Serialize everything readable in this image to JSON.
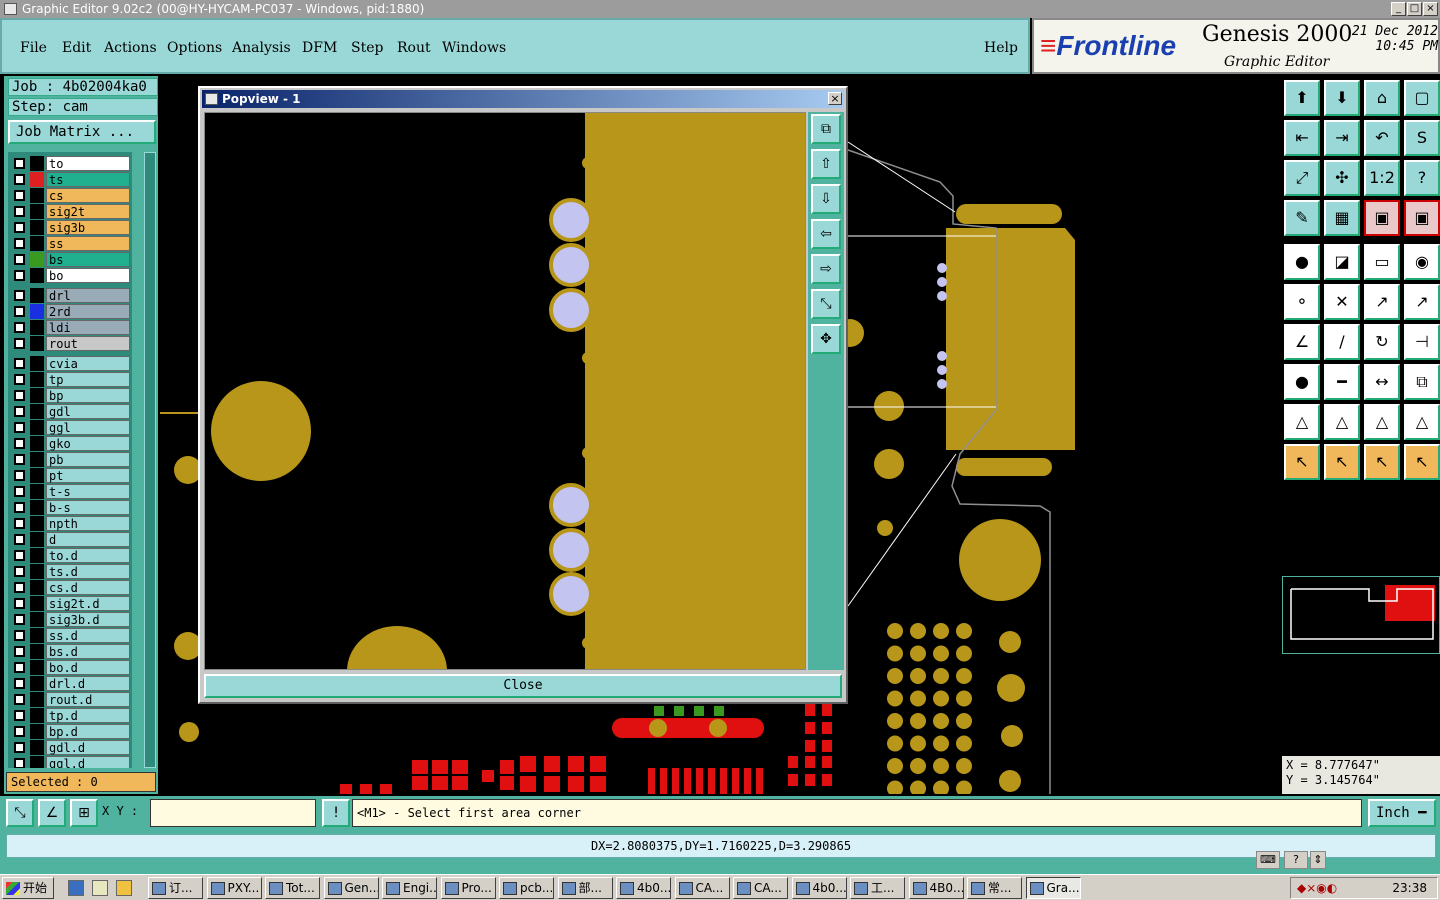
{
  "window": {
    "title": "Graphic Editor 9.02c2 (00@HY-HYCAM-PC037 - Windows, pid:1880)"
  },
  "menu": {
    "items": [
      "File",
      "Edit",
      "Actions",
      "Options",
      "Analysis",
      "DFM",
      "Step",
      "Rout",
      "Windows"
    ],
    "help": "Help"
  },
  "brand": {
    "logo": "Frontline",
    "product": "Genesis 2000",
    "subtitle": "Graphic Editor",
    "date": "21 Dec 2012",
    "time": "10:45 PM"
  },
  "job": {
    "job_label": "Job : 4b02004ka0",
    "step_label": "Step: cam",
    "matrix_button": "Job Matrix ..."
  },
  "layers": [
    {
      "name": "to",
      "bg": "#ffffff",
      "swatch": "#000000"
    },
    {
      "name": "ts",
      "bg": "#20b090",
      "swatch": "#e02020",
      "active": true
    },
    {
      "name": "cs",
      "bg": "#f0b85a",
      "swatch": "#000000"
    },
    {
      "name": "sig2t",
      "bg": "#f0b85a",
      "swatch": "#000000"
    },
    {
      "name": "sig3b",
      "bg": "#f0b85a",
      "swatch": "#000000"
    },
    {
      "name": "ss",
      "bg": "#f0b85a",
      "swatch": "#000000"
    },
    {
      "name": "bs",
      "bg": "#20b090",
      "swatch": "#3a9a20"
    },
    {
      "name": "bo",
      "bg": "#ffffff",
      "swatch": "#000000"
    },
    {
      "name": "drl",
      "bg": "#9aabb8",
      "swatch": "#000000",
      "gap": true
    },
    {
      "name": "2rd",
      "bg": "#9aabb8",
      "swatch": "#1a30e0"
    },
    {
      "name": "ldi",
      "bg": "#9aabb8",
      "swatch": "#000000"
    },
    {
      "name": "rout",
      "bg": "#c8c8c8",
      "swatch": "#000000"
    },
    {
      "name": "cvia",
      "bg": "#9ad8d8",
      "swatch": "#000000",
      "gap": true
    },
    {
      "name": "tp",
      "bg": "#9ad8d8",
      "swatch": "#000000"
    },
    {
      "name": "bp",
      "bg": "#9ad8d8",
      "swatch": "#000000"
    },
    {
      "name": "gdl",
      "bg": "#9ad8d8",
      "swatch": "#000000"
    },
    {
      "name": "ggl",
      "bg": "#9ad8d8",
      "swatch": "#000000"
    },
    {
      "name": "gko",
      "bg": "#9ad8d8",
      "swatch": "#000000"
    },
    {
      "name": "pb",
      "bg": "#9ad8d8",
      "swatch": "#000000"
    },
    {
      "name": "pt",
      "bg": "#9ad8d8",
      "swatch": "#000000"
    },
    {
      "name": "t-s",
      "bg": "#9ad8d8",
      "swatch": "#000000"
    },
    {
      "name": "b-s",
      "bg": "#9ad8d8",
      "swatch": "#000000"
    },
    {
      "name": "npth",
      "bg": "#9ad8d8",
      "swatch": "#000000"
    },
    {
      "name": "d",
      "bg": "#9ad8d8",
      "swatch": "#000000"
    },
    {
      "name": "to.d",
      "bg": "#9ad8d8",
      "swatch": "#000000"
    },
    {
      "name": "ts.d",
      "bg": "#9ad8d8",
      "swatch": "#000000"
    },
    {
      "name": "cs.d",
      "bg": "#9ad8d8",
      "swatch": "#000000"
    },
    {
      "name": "sig2t.d",
      "bg": "#9ad8d8",
      "swatch": "#000000"
    },
    {
      "name": "sig3b.d",
      "bg": "#9ad8d8",
      "swatch": "#000000"
    },
    {
      "name": "ss.d",
      "bg": "#9ad8d8",
      "swatch": "#000000"
    },
    {
      "name": "bs.d",
      "bg": "#9ad8d8",
      "swatch": "#000000"
    },
    {
      "name": "bo.d",
      "bg": "#9ad8d8",
      "swatch": "#000000"
    },
    {
      "name": "drl.d",
      "bg": "#9ad8d8",
      "swatch": "#000000"
    },
    {
      "name": "rout.d",
      "bg": "#9ad8d8",
      "swatch": "#000000"
    },
    {
      "name": "tp.d",
      "bg": "#9ad8d8",
      "swatch": "#000000"
    },
    {
      "name": "bp.d",
      "bg": "#9ad8d8",
      "swatch": "#000000"
    },
    {
      "name": "gdl.d",
      "bg": "#9ad8d8",
      "swatch": "#000000"
    },
    {
      "name": "ggl.d",
      "bg": "#9ad8d8",
      "swatch": "#000000"
    }
  ],
  "selected": "Selected : 0",
  "popview": {
    "title": "Popview - 1",
    "close_label": "Close"
  },
  "coords": {
    "x": "X = 8.777647\"",
    "y": "Y = 3.145764\""
  },
  "cmd": {
    "xy_label": "X Y :",
    "xy_value": "",
    "prompt": "<M1> - Select first area corner",
    "units": "Inch"
  },
  "measure": "DX=2.8080375,DY=1.7160225,D=3.290865",
  "taskbar": {
    "start": "开始",
    "tasks": [
      "订...",
      "PXY...",
      "Tot...",
      "Gen...",
      "Engi...",
      "Pro...",
      "pcb...",
      "部...",
      "4b0...",
      "CA...",
      "CA...",
      "4b0...",
      "工...",
      "4B0...",
      "常...",
      "Gra..."
    ],
    "clock": "23:38"
  },
  "colors": {
    "copper": "#b8961a",
    "pad": "#c4c4f0",
    "mask": "#e01010",
    "silk": "#3a9a20",
    "panel": "#4fb3a0",
    "button": "#9ad8d8"
  }
}
